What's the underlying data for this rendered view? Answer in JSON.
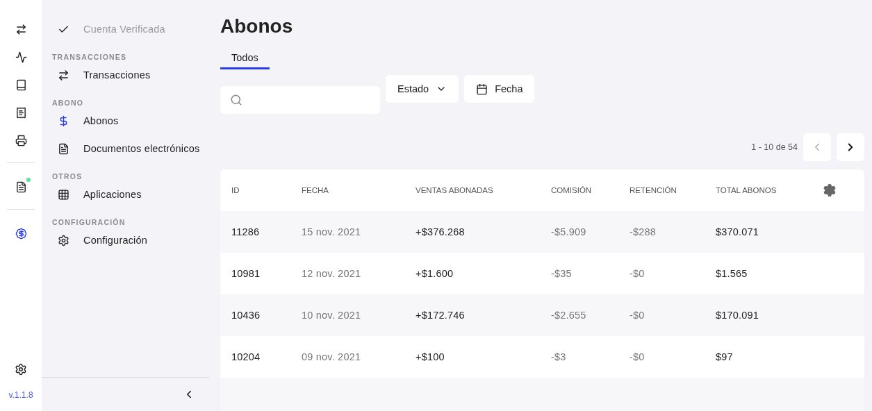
{
  "rail": {
    "groups": [
      [
        {
          "selected": false
        },
        {
          "selected": false
        },
        {
          "selected": false
        },
        {
          "selected": false
        },
        {
          "selected": false
        }
      ],
      [
        {
          "selected": false,
          "badge": true
        }
      ],
      [
        {
          "selected": true
        }
      ]
    ],
    "version": "v.1.1.8"
  },
  "nav": {
    "account": {
      "label": "Cuenta Verificada",
      "disabled": true
    },
    "sections": [
      {
        "title": "TRANSACCIONES",
        "items": [
          {
            "label": "Transacciones",
            "selected": false
          }
        ]
      },
      {
        "title": "ABONO",
        "items": [
          {
            "label": "Abonos",
            "selected": true
          },
          {
            "label": "Documentos electrónicos",
            "selected": false
          }
        ]
      },
      {
        "title": "OTROS",
        "items": [
          {
            "label": "Aplicaciones",
            "selected": false
          }
        ]
      },
      {
        "title": "CONFIGURACIÓN",
        "items": [
          {
            "label": "Configuración",
            "selected": false
          }
        ]
      }
    ]
  },
  "page": {
    "title": "Abonos",
    "tabs": [
      {
        "label": "Todos",
        "selected": true
      }
    ],
    "filters": [
      {
        "label": "Estado",
        "kind": "dropdown"
      },
      {
        "label": "Fecha",
        "kind": "date"
      }
    ],
    "pagination": {
      "range": "1 - 10 de 54",
      "prev_disabled": true,
      "next_disabled": false
    },
    "table": {
      "columns": [
        "ID",
        "FECHA",
        "VENTAS ABONADAS",
        "COMISIÓN",
        "RETENCIÓN",
        "TOTAL ABONOS"
      ],
      "rows": [
        [
          "11286",
          "15 nov. 2021",
          "+$376.268",
          "-$5.909",
          "-$288",
          "$370.071"
        ],
        [
          "10981",
          "12 nov. 2021",
          "+$1.600",
          "-$35",
          "-$0",
          "$1.565"
        ],
        [
          "10436",
          "10 nov. 2021",
          "+$172.746",
          "-$2.655",
          "-$0",
          "$170.091"
        ],
        [
          "10204",
          "09 nov. 2021",
          "+$100",
          "-$3",
          "-$0",
          "$97"
        ]
      ]
    }
  }
}
